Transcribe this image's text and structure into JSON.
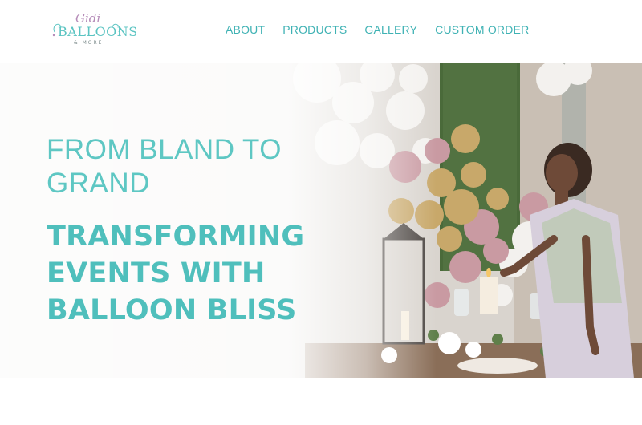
{
  "header": {
    "logo": {
      "script_text": "Gidi",
      "word_text": "BALLOONS",
      "sub_text": "& MORE"
    },
    "nav": [
      {
        "label": "ABOUT"
      },
      {
        "label": "PRODUCTS"
      },
      {
        "label": "GALLERY"
      },
      {
        "label": "CUSTOM ORDER"
      }
    ]
  },
  "hero": {
    "headline": "FROM BLAND TO GRAND",
    "tagline": "TRANSFORMING EVENTS WITH BALLOON BLISS",
    "image_subject": "woman-lighting-candle-balloon-garland"
  },
  "colors": {
    "accent": "#5ec7c3",
    "logo_script": "#b58bb8",
    "balloon_gold": "#c8a86a",
    "balloon_pink": "#c99aa2",
    "balloon_white": "#f3f1ee"
  }
}
